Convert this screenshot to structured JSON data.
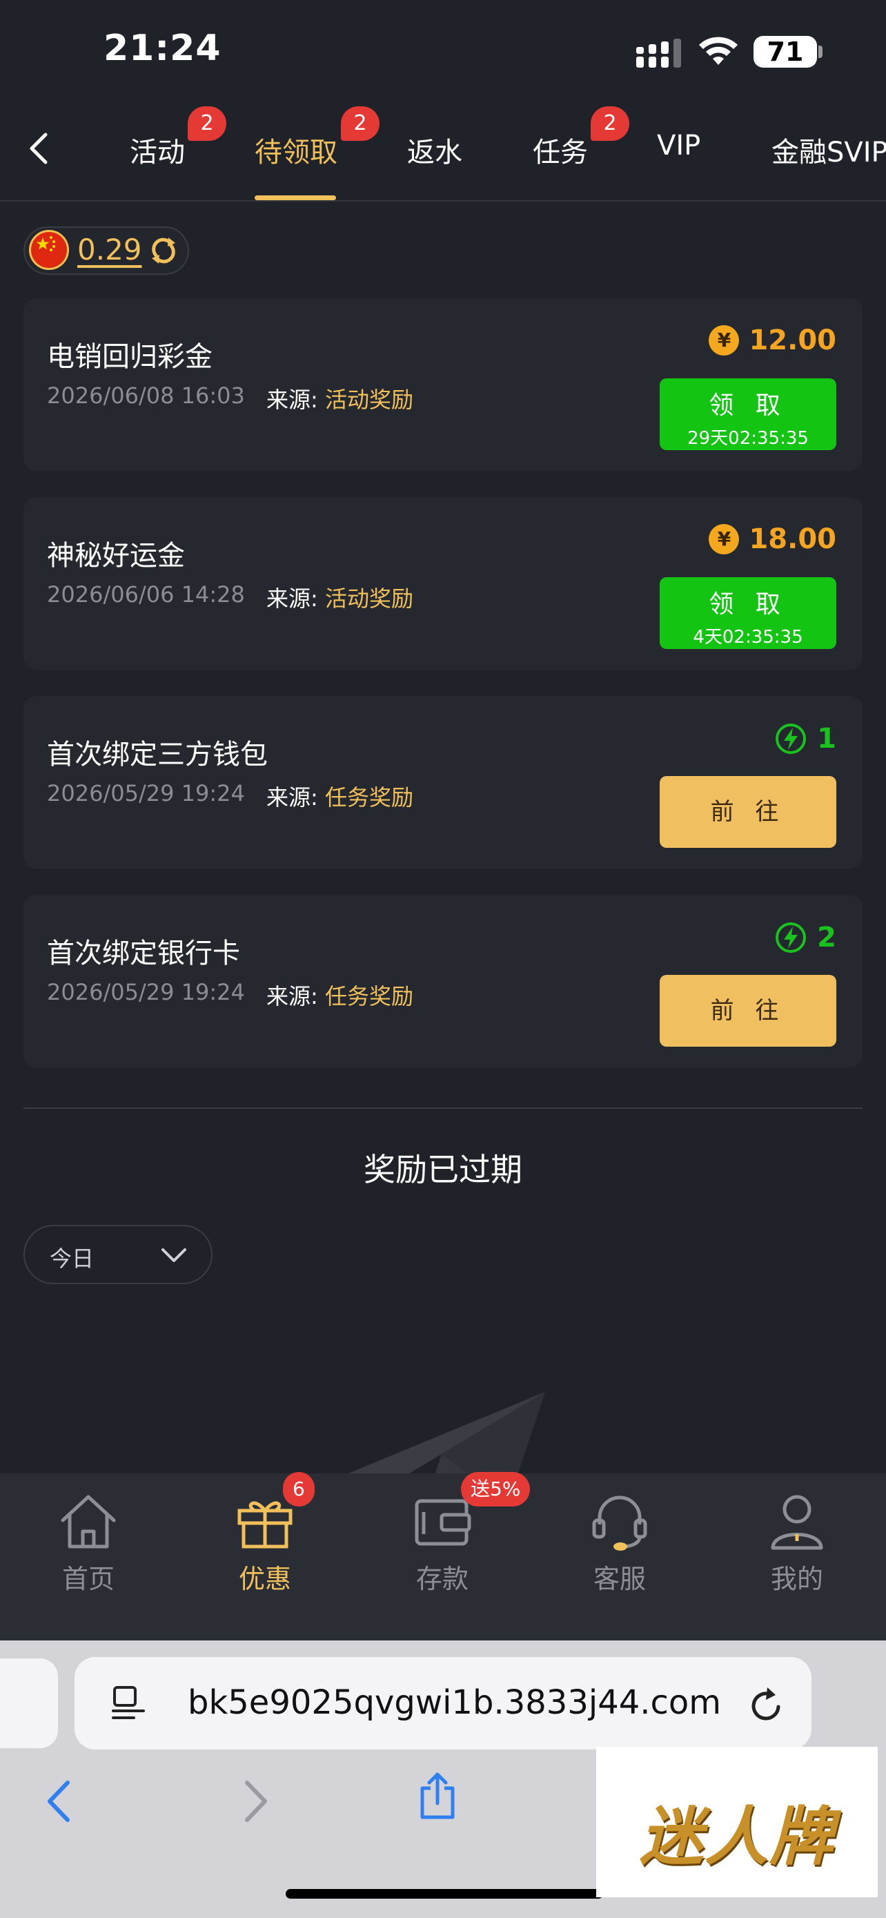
{
  "status_bar": {
    "time": "21:24",
    "battery": "71"
  },
  "tabs": [
    {
      "label": "活动",
      "badge": "2"
    },
    {
      "label": "待领取",
      "badge": "2",
      "active": true
    },
    {
      "label": "返水"
    },
    {
      "label": "任务",
      "badge": "2"
    },
    {
      "label": "VIP"
    },
    {
      "label": "金融SVIP"
    }
  ],
  "balance": {
    "value": "0.29"
  },
  "rewards": [
    {
      "title": "电销回归彩金",
      "date": "2026/06/08 16:03",
      "source_label": "来源:",
      "source_value": "活动奖励",
      "amount_symbol": "¥",
      "amount": "12.00",
      "button_label": "领 取",
      "countdown": "29天02:35:35"
    },
    {
      "title": "神秘好运金",
      "date": "2026/06/06 14:28",
      "source_label": "来源:",
      "source_value": "活动奖励",
      "amount_symbol": "¥",
      "amount": "18.00",
      "button_label": "领 取",
      "countdown": "4天02:35:35"
    },
    {
      "title": "首次绑定三方钱包",
      "date": "2026/05/29 19:24",
      "source_label": "来源:",
      "source_value": "任务奖励",
      "amount": "1",
      "button_label": "前 往"
    },
    {
      "title": "首次绑定银行卡",
      "date": "2026/05/29 19:24",
      "source_label": "来源:",
      "source_value": "任务奖励",
      "amount": "2",
      "button_label": "前 往"
    }
  ],
  "expired": {
    "title": "奖励已过期",
    "filter_label": "今日"
  },
  "bottom_nav": [
    {
      "label": "首页",
      "icon": "home-icon"
    },
    {
      "label": "优惠",
      "icon": "gift-icon",
      "badge": "6",
      "active": true
    },
    {
      "label": "存款",
      "icon": "wallet-icon",
      "badge": "送5%"
    },
    {
      "label": "客服",
      "icon": "headset-icon"
    },
    {
      "label": "我的",
      "icon": "profile-icon"
    }
  ],
  "browser": {
    "url": "bk5e9025qvgwi1b.3833j44.com"
  },
  "watermark": {
    "text": "迷人牌"
  },
  "colors": {
    "accent": "#f1c05b",
    "claim_green": "#13c413",
    "amount_orange": "#f7a520",
    "background": "#1f2228"
  }
}
